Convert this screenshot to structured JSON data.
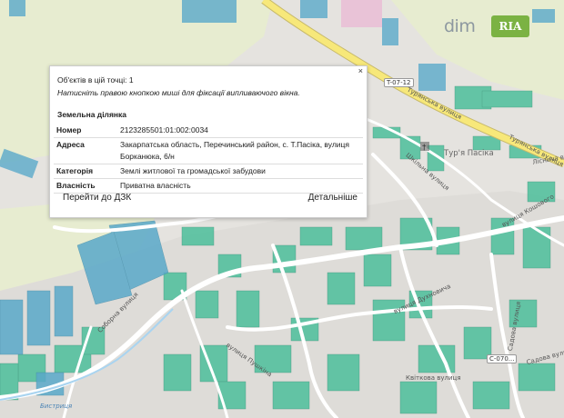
{
  "map": {
    "road_badges": [
      "T-07-12",
      "C-070..."
    ],
    "labels": [
      {
        "name": "street-label-turianska-1",
        "text": "Турянська вулиця"
      },
      {
        "name": "street-label-turianska-2",
        "text": "Турянська вулиця"
      },
      {
        "name": "street-label-soborna",
        "text": "Соборна вулиця"
      },
      {
        "name": "street-label-shkilna",
        "text": "Шкільна вулиця"
      },
      {
        "name": "street-label-duhnovycha",
        "text": "вулиця Духновича"
      },
      {
        "name": "street-label-sadova",
        "text": "Садова вулиця"
      },
      {
        "name": "street-label-sadova-2",
        "text": "Садова вулиця"
      },
      {
        "name": "street-label-kvitkova",
        "text": "Квіткова вулиця"
      },
      {
        "name": "street-label-pushkina",
        "text": "вулиця Пушкіна"
      },
      {
        "name": "street-label-kosheva",
        "text": "вулиця Кошового"
      },
      {
        "name": "street-label-other",
        "text": "Ліснича вулиця"
      },
      {
        "name": "place-label-tur-pasika",
        "text": "Тур'я Пасіка"
      },
      {
        "name": "river-label",
        "text": "Бистриця"
      }
    ]
  },
  "logo": {
    "left": "dim",
    "right": "RIA"
  },
  "popup": {
    "close": "×",
    "count": "Об'єктів в цій точці: 1",
    "hint": "Натисніть правою кнопкою миші для фіксації випливаючого вікна.",
    "section": "Земельна ділянка",
    "rows": [
      {
        "key": "Номер",
        "value": "2123285501:01:002:0034"
      },
      {
        "key": "Адреса",
        "value": "Закарпатська область, Перечинський район, с. Т.Пасіка, вулиця Борканюка, 6/н"
      },
      {
        "key": "Категорія",
        "value": "Землі житлової та громадської забудови"
      },
      {
        "key": "Власність",
        "value": "Приватна власність"
      }
    ],
    "link_dzk": "Перейти до ДЗК",
    "link_more": "Детальніше"
  },
  "colors": {
    "parcel": "#4dbf9c",
    "parcel_blue": "#5aa9c9",
    "road": "#ffffff",
    "main_road": "#f7e87a",
    "forest": "#e7eccf"
  }
}
